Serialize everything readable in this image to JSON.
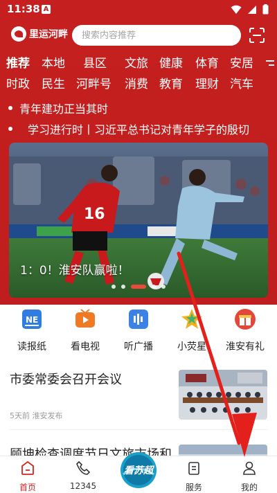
{
  "status_bar": {
    "time": "11:38",
    "app_letter": "A"
  },
  "header": {
    "logo_text": "里运河畔",
    "search_placeholder": "搜索内容推荐"
  },
  "nav": {
    "row1": [
      "推荐",
      "本地",
      "县区",
      "文旅",
      "健康",
      "体育",
      "安居"
    ],
    "row2": [
      "时政",
      "民生",
      "河畔号",
      "消费",
      "教育",
      "理财",
      "汽车"
    ]
  },
  "ticker": [
    "青年建功正当其时",
    "学习进行时丨习近平总书记对青年学子的殷切"
  ],
  "banner": {
    "caption": "1：0！淮安队赢啦！",
    "slides": 5,
    "active_slide": 3
  },
  "shortcuts": [
    {
      "label": "读报纸",
      "icon": "newspaper-icon",
      "color": "#2f7de1"
    },
    {
      "label": "看电视",
      "icon": "tv-icon",
      "color": "#f07a24"
    },
    {
      "label": "听广播",
      "icon": "radio-icon",
      "color": "#3b82e6"
    },
    {
      "label": "小荧星",
      "icon": "star-icon",
      "color": "#f2b01c"
    },
    {
      "label": "淮安有礼",
      "icon": "gift-icon",
      "color": "#e5463a"
    }
  ],
  "news": [
    {
      "title": "市委常委会召开会议",
      "meta": "5天前  淮安发布"
    },
    {
      "title": "顾坤检查调度节日文旅市场和"
    }
  ],
  "bottom_nav": {
    "home": "首页",
    "hotline": "12345",
    "center_badge": "看苏超",
    "service": "服务",
    "mine": "我的"
  },
  "colors": {
    "brand_red": "#c5201f",
    "active_tab": "#d2261f",
    "annotation_arrow": "#e3201b"
  }
}
